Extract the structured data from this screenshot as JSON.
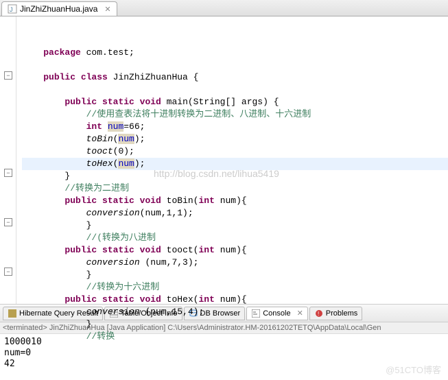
{
  "editor": {
    "tab": {
      "filename": "JinZhiZhuanHua.java"
    },
    "code": {
      "l1_pkg": "package",
      "l1_pkgname": " com.test;",
      "l3_pub": "public",
      "l3_cls": " class",
      "l3_name": " JinZhiZhuanHua {",
      "l5_sig1": "public",
      "l5_sig2": " static",
      "l5_sig3": " void",
      "l5_main": " main",
      "l5_args": "(String[] args) {",
      "l6_comment": "//使用查表法将十进制转换为二进制、八进制、十六进制",
      "l7_int": "int",
      "l7_num": "num",
      "l7_val": "=66;",
      "l8_tobin": "toBin",
      "l8_arg": "(",
      "l8_num": "num",
      "l8_end": ");",
      "l9_tooct": "tooct",
      "l9_arg": "(0);",
      "l10_tohex": "toHex",
      "l10_arg": "(",
      "l10_num": "num",
      "l10_end": ");",
      "l11_brace": "}",
      "l12_comment": "//转换为二进制",
      "l13_sig1": "public",
      "l13_sig2": " static",
      "l13_sig3": " void",
      "l13_name": " toBin",
      "l13_args": "(",
      "l13_int": "int",
      "l13_rest": " num){",
      "l14_conv": "conversion",
      "l14_args": "(num,1,1);",
      "l15_brace": "}",
      "l16_comment": "//(转换为八进制",
      "l17_sig1": "public",
      "l17_sig2": " static",
      "l17_sig3": " void",
      "l17_name": " tooct",
      "l17_args": "(",
      "l17_int": "int",
      "l17_rest": " num){",
      "l18_conv": "conversion",
      "l18_args": " (num,7,3);",
      "l19_brace": "}",
      "l20_comment": "//转换为十六进制",
      "l21_sig1": "public",
      "l21_sig2": " static",
      "l21_sig3": " void",
      "l21_name": " toHex",
      "l21_args": "(",
      "l21_int": "int",
      "l21_rest": " num){",
      "l22_conv": "conversion",
      "l22_args": " (num,15,4);",
      "l23_brace": "}",
      "l24_comment": "//转换"
    }
  },
  "watermark": "http://blog.csdn.net/lihua5419",
  "bottom_watermark": "@51CTO博客",
  "bottomTabs": {
    "hibernate": "Hibernate Query Result",
    "table": "Table/Object Info",
    "dbbrowser": "DB Browser",
    "console": "Console",
    "problems": "Problems"
  },
  "console": {
    "terminated": "<terminated> JinZhiZhuanHua [Java Application] C:\\Users\\Administrator.HM-20161202TETQ\\AppData\\Local\\Gen",
    "out1": "1000010",
    "out2": "num=0",
    "out3": "42"
  }
}
